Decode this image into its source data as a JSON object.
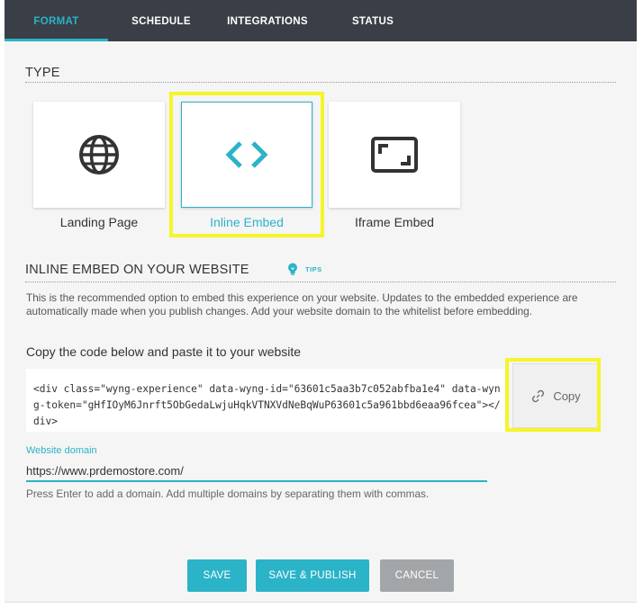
{
  "tabs": [
    {
      "label": "FORMAT",
      "active": true
    },
    {
      "label": "SCHEDULE",
      "active": false
    },
    {
      "label": "INTEGRATIONS",
      "active": false
    },
    {
      "label": "STATUS",
      "active": false
    }
  ],
  "type_section": {
    "title": "TYPE",
    "options": [
      {
        "label": "Landing Page",
        "icon": "globe-icon",
        "selected": false
      },
      {
        "label": "Inline Embed",
        "icon": "code-brackets-icon",
        "selected": true
      },
      {
        "label": "Iframe Embed",
        "icon": "frame-corners-icon",
        "selected": false
      }
    ]
  },
  "embed_section": {
    "title": "INLINE EMBED ON YOUR WEBSITE",
    "tips_label": "TIPS",
    "description": "This is the recommended option to embed this experience on your website. Updates to the embedded experience are automatically made when you publish changes. Add your website domain to the whitelist before embedding.",
    "copy_heading": "Copy the code below and paste it to your website",
    "code": "<div class=\"wyng-experience\" data-wyng-id=\"63601c5aa3b7c052abfba1e4\" data-wyng-token=\"gHfIOyM6Jnrft5ObGedaLwjuHqkVTNXVdNeBqWuP63601c5a961bbd6eaa96fcea\"></div>",
    "copy_label": "Copy",
    "domain_label": "Website domain",
    "domain_value": "https://www.prdemostore.com/",
    "domain_hint": "Press Enter to add a domain. Add multiple domains by separating them with commas."
  },
  "actions": {
    "save": "SAVE",
    "save_publish": "SAVE & PUBLISH",
    "cancel": "CANCEL"
  },
  "colors": {
    "accent": "#2bb3c8",
    "tabbar": "#3a3f47",
    "highlight": "#f5f52a",
    "cancel": "#a3a6a8"
  }
}
